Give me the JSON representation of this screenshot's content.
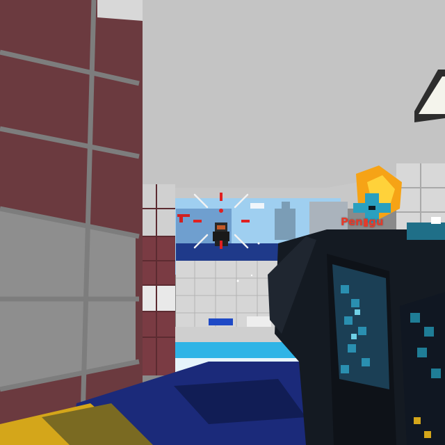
{
  "hud": {
    "enemy_name": "Pen▮gu",
    "crosshair_color": "#e02020",
    "hit_marker_color": "#f2f2f2"
  },
  "colors": {
    "wall_tile_red": "#6b3a3f",
    "wall_tile_grey": "#8e8e8e",
    "ceiling": "#c9c9c9",
    "sky": "#9fcff0",
    "water": "#2fb4e6",
    "gun_dark": "#141a22",
    "gun_cyan": "#1f7d96",
    "floor_blue": "#1b2a7a",
    "floor_yellow": "#d4a61a",
    "fire": "#f6a316"
  }
}
